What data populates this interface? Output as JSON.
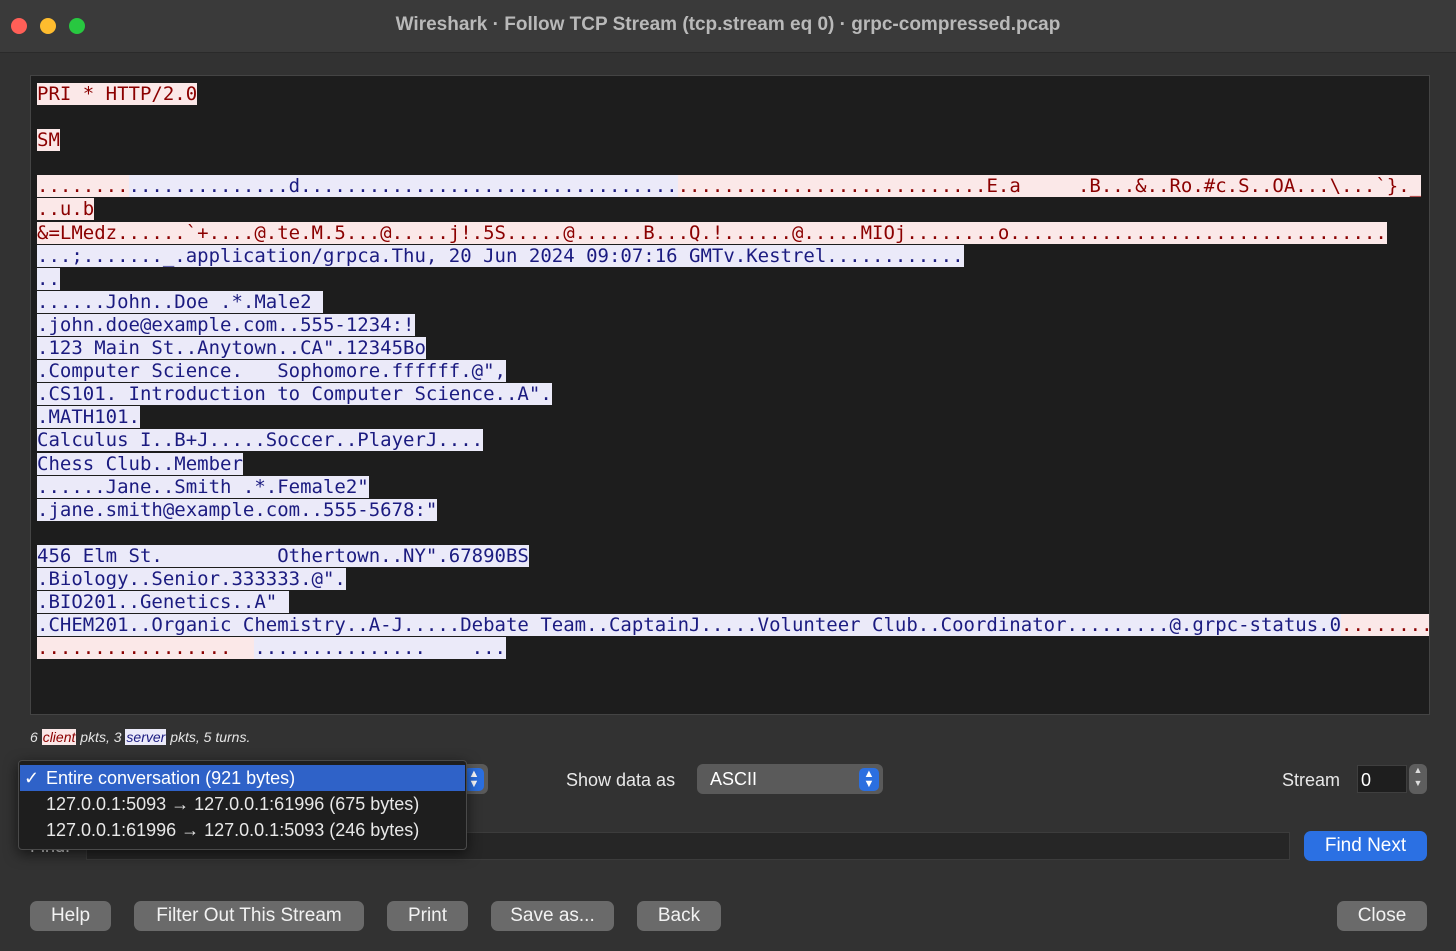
{
  "window": {
    "title": "Wireshark · Follow TCP Stream (tcp.stream eq 0) · grpc-compressed.pcap"
  },
  "stream_lines": [
    [
      {
        "t": "PRI * HTTP/2.0",
        "k": "c"
      }
    ],
    [],
    [
      {
        "t": "SM",
        "k": "c"
      }
    ],
    [],
    [
      {
        "t": "........",
        "k": "c"
      },
      {
        "t": "..............d.................................",
        "k": "s"
      },
      {
        "t": "...........................E.a     .B...&..Ro.#c.S..OA...\\...`}._",
        "k": "c"
      }
    ],
    [
      {
        "t": "..u.b",
        "k": "c"
      }
    ],
    [
      {
        "t": "&=LMedz......`+....@.te.M.5...@.....j!.5S.....@......B...Q.!......@.....MIOj........o.................................",
        "k": "c"
      }
    ],
    [
      {
        "t": "...;......._.application/grpca.Thu, 20 Jun 2024 09:07:16 GMTv.Kestrel............",
        "k": "s"
      }
    ],
    [
      {
        "t": "..",
        "k": "s"
      }
    ],
    [
      {
        "t": "......John..Doe .*.Male2 ",
        "k": "s"
      }
    ],
    [
      {
        "t": ".john.doe@example.com..555-1234:!",
        "k": "s"
      }
    ],
    [
      {
        "t": ".123 Main St..Anytown..CA\".12345Bo",
        "k": "s"
      }
    ],
    [
      {
        "t": ".Computer Science.   Sophomore.ffffff.@\",",
        "k": "s"
      }
    ],
    [
      {
        "t": ".CS101. Introduction to Computer Science..A\".",
        "k": "s"
      }
    ],
    [
      {
        "t": ".MATH101.",
        "k": "s"
      }
    ],
    [
      {
        "t": "Calculus I..B+J.....Soccer..PlayerJ....",
        "k": "s"
      }
    ],
    [
      {
        "t": "Chess Club..Member",
        "k": "s"
      }
    ],
    [
      {
        "t": "......Jane..Smith .*.Female2\"",
        "k": "s"
      }
    ],
    [
      {
        "t": ".jane.smith@example.com..555-5678:\"",
        "k": "s"
      }
    ],
    [],
    [
      {
        "t": "456 Elm St.          Othertown..NY\".67890BS",
        "k": "s"
      }
    ],
    [
      {
        "t": ".Biology..Senior.333333.@\".",
        "k": "s"
      }
    ],
    [
      {
        "t": ".BIO201..Genetics..A\" ",
        "k": "s"
      }
    ],
    [
      {
        "t": ".CHEM201..Organic Chemistry..A-J.....Debate Team..CaptainJ.....Volunteer Club..Coordinator.........@.grpc-status.0",
        "k": "s"
      },
      {
        "t": "........",
        "k": "c"
      }
    ],
    [
      {
        "t": ".................  ",
        "k": "c"
      },
      {
        "t": "...............    ...",
        "k": "s"
      }
    ]
  ],
  "stats": {
    "count1": "6",
    "client_label": "client",
    "mid1": "pkts, 3",
    "server_label": "server",
    "mid2": "pkts, 5 turns."
  },
  "conversation": {
    "options": [
      {
        "check": "✓",
        "label": "Entire conversation (921 bytes)"
      },
      {
        "check": "",
        "label": "127.0.0.1:5093 → 127.0.0.1:61996 (675 bytes)"
      },
      {
        "check": "",
        "label": "127.0.0.1:61996 → 127.0.0.1:5093 (246 bytes)"
      }
    ]
  },
  "show_data": {
    "label": "Show data as",
    "value": "ASCII"
  },
  "stream_selector": {
    "label": "Stream",
    "value": "0"
  },
  "find": {
    "label": "Find:",
    "value": "",
    "next_label": "Find Next"
  },
  "buttons": {
    "help": "Help",
    "filter_out": "Filter Out This Stream",
    "print": "Print",
    "save_as": "Save as...",
    "back": "Back",
    "close": "Close"
  },
  "colors": {
    "client_bg": "#fbe8e8",
    "client_fg": "#8b0000",
    "server_bg": "#ebeaf9",
    "server_fg": "#1b1b80",
    "accent": "#2b70e3"
  }
}
